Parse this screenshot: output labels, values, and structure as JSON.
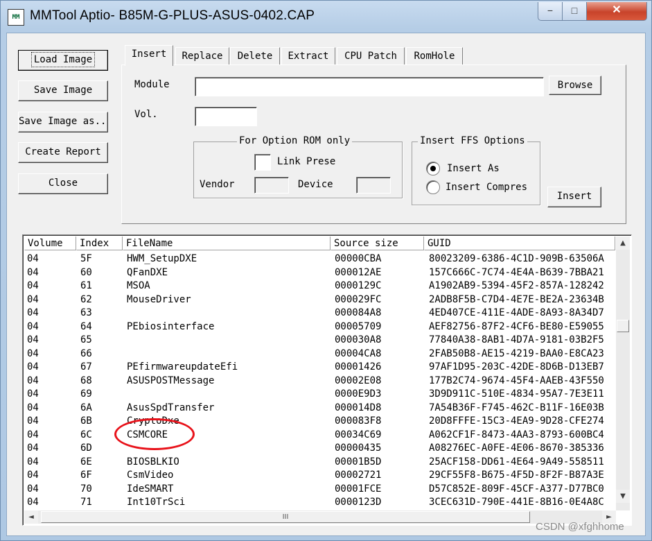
{
  "window": {
    "app_icon": "MM",
    "title": "MMTool Aptio- B85M-G-PLUS-ASUS-0402.CAP",
    "minimize_glyph": "−",
    "maximize_glyph": "□",
    "close_glyph": "✕"
  },
  "left_buttons": {
    "load": "Load Image",
    "save": "Save Image",
    "save_as": "Save Image as...",
    "report": "Create Report",
    "close": "Close"
  },
  "tabs": [
    "Insert",
    "Replace",
    "Delete",
    "Extract",
    "CPU Patch",
    "RomHole"
  ],
  "insert_tab": {
    "module_label": "Module",
    "module_value": "",
    "browse": "Browse",
    "vol_label": "Vol.",
    "vol_value": "",
    "option_rom_group": "For Option ROM only",
    "link_present": "Link Prese",
    "vendor_label": "Vendor",
    "device_label": "Device",
    "ffs_group": "Insert FFS Options",
    "insert_as": "Insert As",
    "insert_compressed": "Insert Compres",
    "insert_button": "Insert"
  },
  "table": {
    "columns": [
      "Volume",
      "Index",
      "FileName",
      "Source size",
      "GUID"
    ],
    "rows": [
      [
        "04",
        "5F",
        "HWM_SetupDXE",
        "00000CBA",
        "80023209-6386-4C1D-909B-63506A"
      ],
      [
        "04",
        "60",
        "QFanDXE",
        "000012AE",
        "157C666C-7C74-4E4A-B639-7BBA21"
      ],
      [
        "04",
        "61",
        "MSOA",
        "0000129C",
        "A1902AB9-5394-45F2-857A-128242"
      ],
      [
        "04",
        "62",
        "MouseDriver",
        "000029FC",
        "2ADB8F5B-C7D4-4E7E-BE2A-23634B"
      ],
      [
        "04",
        "63",
        "",
        "000084A8",
        "4ED407CE-411E-4ADE-8A93-8A34D7"
      ],
      [
        "04",
        "64",
        "PEbiosinterface",
        "00005709",
        "AEF82756-87F2-4CF6-BE80-E59055"
      ],
      [
        "04",
        "65",
        "",
        "000030A8",
        "77840A38-8AB1-4D7A-9181-03B2F5"
      ],
      [
        "04",
        "66",
        "",
        "00004CA8",
        "2FAB50B8-AE15-4219-BAA0-E8CA23"
      ],
      [
        "04",
        "67",
        "PEfirmwareupdateEfi",
        "00001426",
        "97AF1D95-203C-42DE-8D6B-D13EB7"
      ],
      [
        "04",
        "68",
        "ASUSPOSTMessage",
        "00002E08",
        "177B2C74-9674-45F4-AAEB-43F550"
      ],
      [
        "04",
        "69",
        "",
        "0000E9D3",
        "3D9D911C-510E-4834-95A7-7E3E11"
      ],
      [
        "04",
        "6A",
        "AsusSpdTransfer",
        "000014D8",
        "7A54B36F-F745-462C-B11F-16E03B"
      ],
      [
        "04",
        "6B",
        "CryptoDxe",
        "000083F8",
        "20D8FFFE-15C3-4EA9-9D28-CFE274"
      ],
      [
        "04",
        "6C",
        "CSMCORE",
        "00034C69",
        "A062CF1F-8473-4AA3-8793-600BC4"
      ],
      [
        "04",
        "6D",
        "",
        "00000435",
        "A08276EC-A0FE-4E06-8670-385336"
      ],
      [
        "04",
        "6E",
        "BIOSBLKIO",
        "00001B5D",
        "25ACF158-DD61-4E64-9A49-558511"
      ],
      [
        "04",
        "6F",
        "CsmVideo",
        "00002721",
        "29CF55F8-B675-4F5D-8F2F-B87A3E"
      ],
      [
        "04",
        "70",
        "IdeSMART",
        "00001FCE",
        "D57C852E-809F-45CF-A377-D77BC0"
      ],
      [
        "04",
        "71",
        "Int10TrSci",
        "0000123D",
        "3CEC631D-790E-441E-8B16-0E4A8C"
      ]
    ]
  },
  "scrollbar": {
    "up": "▲",
    "down": "▼",
    "left": "◄",
    "right": "►",
    "grip": "III"
  },
  "watermark": "CSDN @xfghhome",
  "highlight_color": "#e8121a"
}
